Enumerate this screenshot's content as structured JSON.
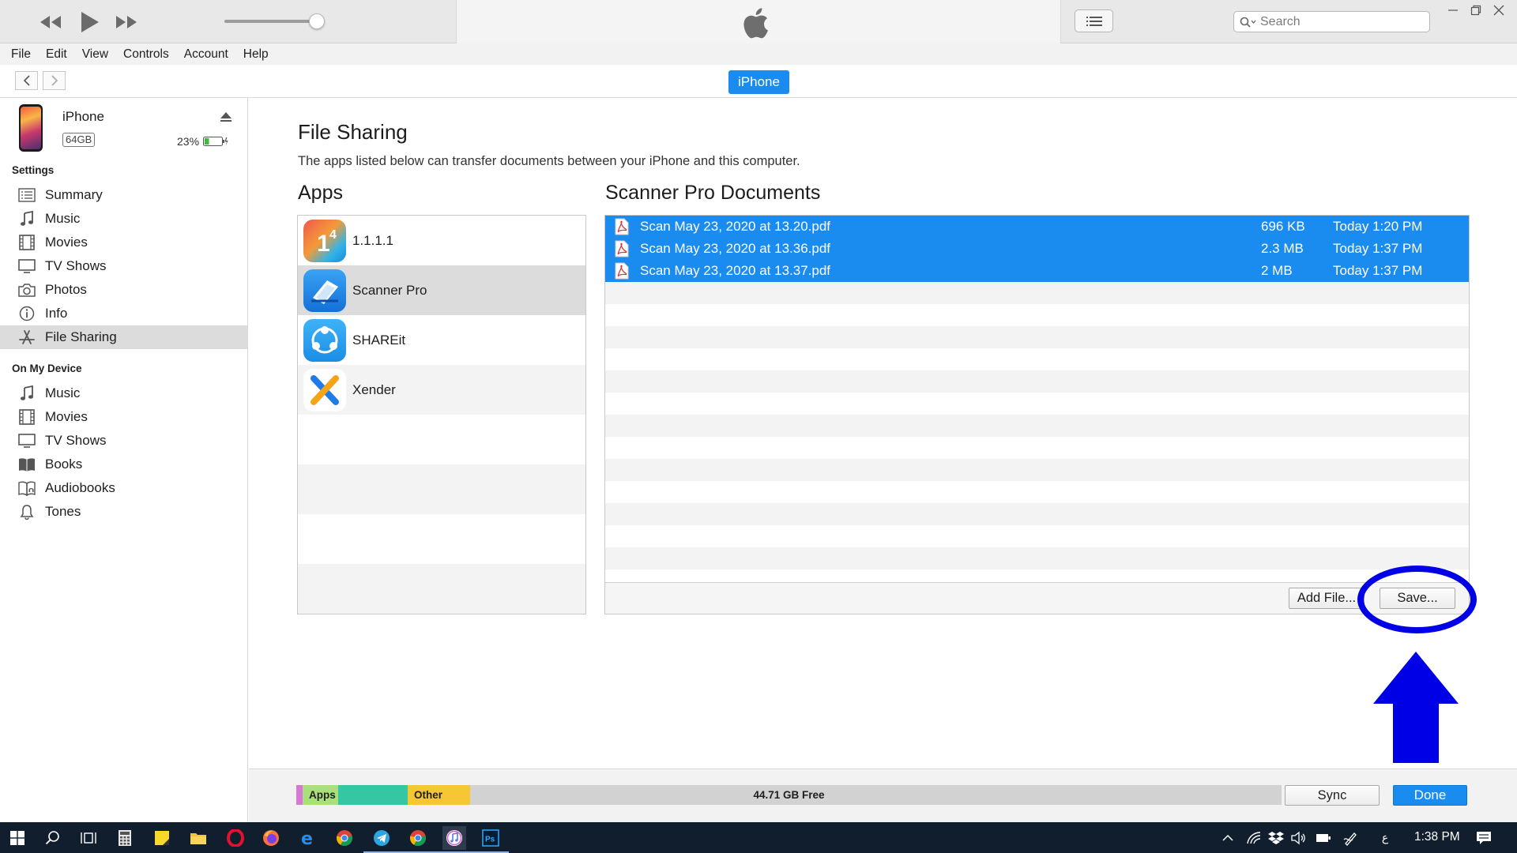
{
  "window": {
    "search_placeholder": "Search",
    "colors": {
      "accent": "#1a8cf0",
      "annotation": "#0000e6",
      "taskbar": "#101e2e"
    }
  },
  "menu": [
    "File",
    "Edit",
    "View",
    "Controls",
    "Account",
    "Help"
  ],
  "navbar": {
    "device_tab": "iPhone"
  },
  "device": {
    "name": "iPhone",
    "capacity": "64GB",
    "battery": "23%"
  },
  "sidebar": {
    "settings_title": "Settings",
    "settings_items": [
      {
        "label": "Summary",
        "icon": "summary-icon"
      },
      {
        "label": "Music",
        "icon": "music-note-icon"
      },
      {
        "label": "Movies",
        "icon": "film-icon"
      },
      {
        "label": "TV Shows",
        "icon": "tv-icon"
      },
      {
        "label": "Photos",
        "icon": "camera-icon"
      },
      {
        "label": "Info",
        "icon": "info-icon"
      },
      {
        "label": "File Sharing",
        "icon": "app-store-icon",
        "selected": true
      }
    ],
    "device_title": "On My Device",
    "device_items": [
      {
        "label": "Music",
        "icon": "music-note-icon"
      },
      {
        "label": "Movies",
        "icon": "film-icon"
      },
      {
        "label": "TV Shows",
        "icon": "tv-icon"
      },
      {
        "label": "Books",
        "icon": "book-icon"
      },
      {
        "label": "Audiobooks",
        "icon": "audiobook-icon"
      },
      {
        "label": "Tones",
        "icon": "bell-icon"
      }
    ]
  },
  "main": {
    "title": "File Sharing",
    "description": "The apps listed below can transfer documents between your iPhone and this computer.",
    "apps_title": "Apps",
    "apps": [
      {
        "name": "1.1.1.1",
        "icon": "cloudflare-1111-icon"
      },
      {
        "name": "Scanner Pro",
        "icon": "scanner-pro-icon",
        "selected": true
      },
      {
        "name": "SHAREit",
        "icon": "shareit-icon"
      },
      {
        "name": "Xender",
        "icon": "xender-icon"
      }
    ],
    "docs_title": "Scanner Pro Documents",
    "documents": [
      {
        "name": "Scan May 23, 2020 at 13.20.pdf",
        "size": "696 KB",
        "date": "Today 1:20 PM"
      },
      {
        "name": "Scan May 23, 2020 at 13.36.pdf",
        "size": "2.3 MB",
        "date": "Today 1:37 PM"
      },
      {
        "name": "Scan May 23, 2020 at 13.37.pdf",
        "size": "2 MB",
        "date": "Today 1:37 PM"
      }
    ],
    "add_file_label": "Add File...",
    "save_label": "Save..."
  },
  "capacity": {
    "segments": [
      {
        "label": "",
        "color": "#d977d9"
      },
      {
        "label": "Apps",
        "color": "#a8e07a"
      },
      {
        "label": "",
        "color": "#35c7a4"
      },
      {
        "label": "Other",
        "color": "#f7c634"
      }
    ],
    "free_label": "44.71 GB Free"
  },
  "footer": {
    "sync_label": "Sync",
    "done_label": "Done"
  },
  "taskbar": {
    "apps": [
      "windows-start-icon",
      "search-icon",
      "task-view-icon",
      "calculator-icon",
      "sticky-notes-icon",
      "file-explorer-icon",
      "opera-icon",
      "firefox-icon",
      "edge-icon",
      "chrome-icon",
      "telegram-icon",
      "chrome-alt-icon",
      "itunes-icon",
      "photoshop-icon"
    ],
    "tray_lang": "ﻉ",
    "time": "1:38 PM"
  }
}
